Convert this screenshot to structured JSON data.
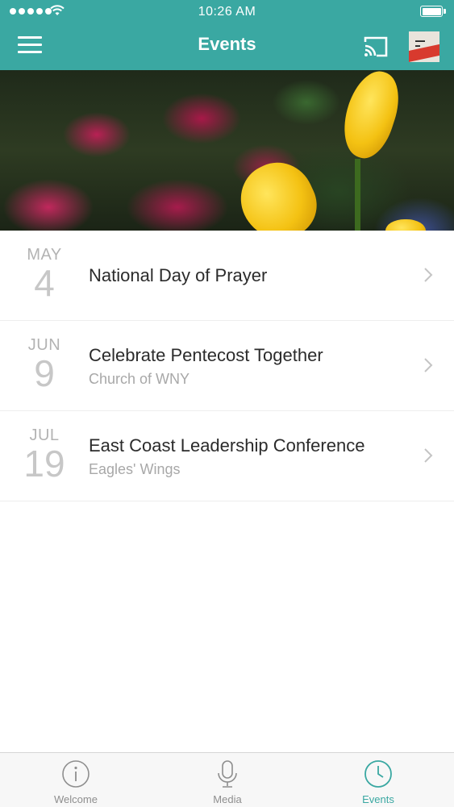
{
  "status_bar": {
    "time": "10:26 AM"
  },
  "nav": {
    "title": "Events"
  },
  "events": [
    {
      "month": "MAY",
      "day": "4",
      "title": "National Day of Prayer",
      "subtitle": ""
    },
    {
      "month": "JUN",
      "day": "9",
      "title": "Celebrate Pentecost Together",
      "subtitle": "Church of WNY"
    },
    {
      "month": "JUL",
      "day": "19",
      "title": "East Coast Leadership Conference",
      "subtitle": "Eagles' Wings"
    }
  ],
  "tabs": [
    {
      "label": "Welcome",
      "icon": "info-icon",
      "active": false
    },
    {
      "label": "Media",
      "icon": "microphone-icon",
      "active": false
    },
    {
      "label": "Events",
      "icon": "clock-icon",
      "active": true
    }
  ],
  "colors": {
    "accent": "#3aa8a2",
    "tab_inactive": "#8e8e8e"
  }
}
